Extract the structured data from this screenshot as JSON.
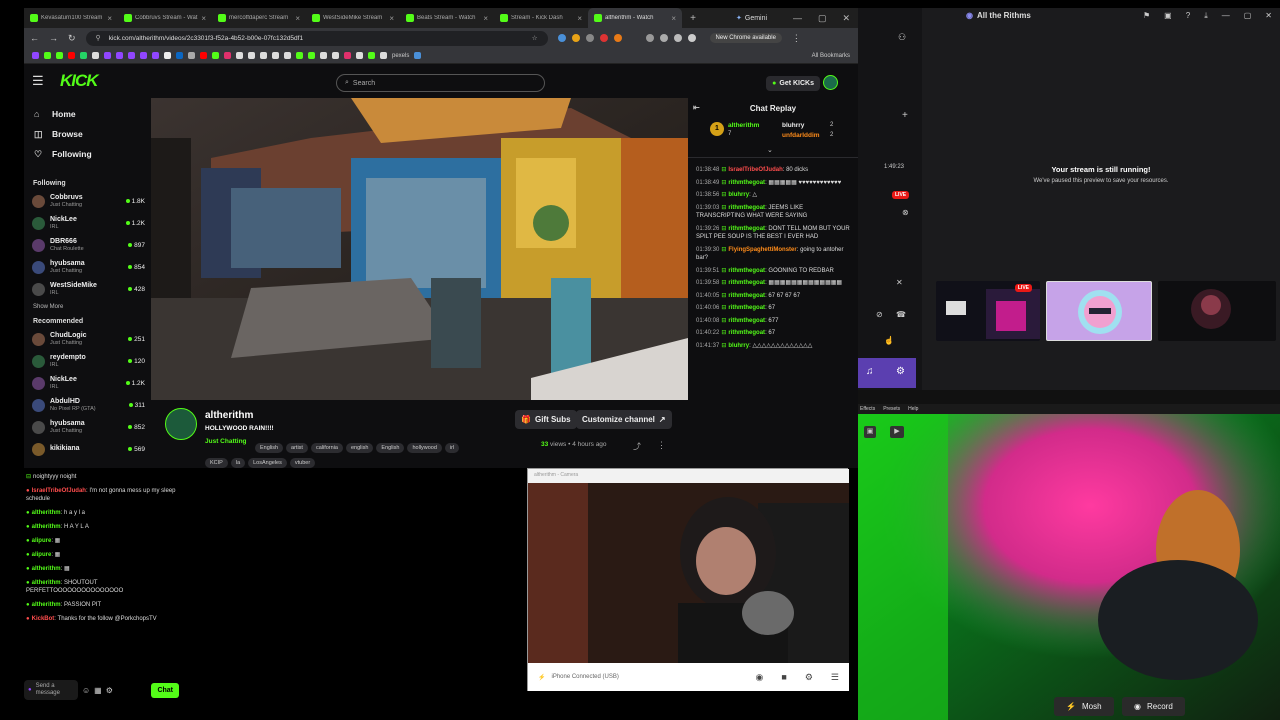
{
  "browser": {
    "tabs": [
      {
        "title": "Kevasaturn100 Stream - W"
      },
      {
        "title": "Cobbruvs Stream - Wat"
      },
      {
        "title": "mercoffdaperc Stream"
      },
      {
        "title": "WestSideMike Stream"
      },
      {
        "title": "Beats Stream - Watch"
      },
      {
        "title": "Stream - Kick Dash"
      },
      {
        "title": "altherithm - Watch"
      }
    ],
    "new_tab": "+",
    "gemini_tab": "Gemini",
    "url": "kick.com/altherithm/videos/2c3301f3-f52a-4b52-b00e-07fc132d5df1",
    "new_chrome": "New Chrome available",
    "bookmark_pexels": "pexels",
    "all_bookmarks": "All Bookmarks"
  },
  "kick": {
    "logo": "KICK",
    "search_placeholder": "Search",
    "get_kicks": "Get KICKs",
    "nav": [
      {
        "label": "Home",
        "icon": "home-icon"
      },
      {
        "label": "Browse",
        "icon": "browse-icon"
      },
      {
        "label": "Following",
        "icon": "heart-icon"
      }
    ],
    "following_header": "Following",
    "following": [
      {
        "name": "Cobbruvs",
        "category": "Just Chatting",
        "viewers": "1.8K"
      },
      {
        "name": "NickLee",
        "category": "IRL",
        "viewers": "1.2K"
      },
      {
        "name": "DBR666",
        "category": "Chat Roulette",
        "viewers": "897"
      },
      {
        "name": "hyubsama",
        "category": "Just Chatting",
        "viewers": "854"
      },
      {
        "name": "WestSideMike",
        "category": "IRL",
        "viewers": "428"
      }
    ],
    "show_more": "Show More",
    "recommended_header": "Recommended",
    "recommended": [
      {
        "name": "ChudLogic",
        "category": "Just Chatting",
        "viewers": "251"
      },
      {
        "name": "reydempto",
        "category": "IRL",
        "viewers": "120"
      },
      {
        "name": "NickLee",
        "category": "IRL",
        "viewers": "1.2K"
      },
      {
        "name": "AbdulHD",
        "category": "No Pixel RP (GTA)",
        "viewers": "311"
      },
      {
        "name": "hyubsama",
        "category": "Just Chatting",
        "viewers": "852"
      },
      {
        "name": "kikikiana",
        "category": "",
        "viewers": "569"
      }
    ],
    "channel": {
      "name": "altherithm",
      "title": "HOLLYWOOD RAIN!!!!",
      "category": "Just Chatting",
      "tags_row1": [
        "English",
        "artist",
        "california",
        "english",
        "English",
        "hollywood",
        "irl"
      ],
      "tags_row2": [
        "KCIP",
        "la",
        "LosAngeles",
        "vtuber"
      ],
      "gift_subs": "Gift Subs",
      "customize": "Customize channel",
      "views_count": "33",
      "views_label": "views",
      "time_ago": "4 hours ago"
    },
    "chat": {
      "title": "Chat Replay",
      "leaders": [
        {
          "rank": "1",
          "name": "altherithm",
          "count": "7"
        },
        {
          "name": "bluhrry",
          "count": "2"
        },
        {
          "name": "unfdarlddim",
          "count": "2"
        }
      ],
      "messages": [
        {
          "time": "01:38:48",
          "user": "IsraelTribeOfJudah",
          "color": "r",
          "text": ": 80 dicks"
        },
        {
          "time": "01:38:49",
          "user": "rithmthegoat",
          "color": "g",
          "text": ": ▦▦▦▦▦ ♥♥♥♥♥♥♥♥♥♥♥♥"
        },
        {
          "time": "01:38:56",
          "user": "bluhrry",
          "color": "g",
          "text": ": △"
        },
        {
          "time": "01:39:03",
          "user": "rithmthegoat",
          "color": "g",
          "text": ": JEEMS LIKE TRANSCRIPTING WHAT WERE SAYING"
        },
        {
          "time": "01:39:26",
          "user": "rithmthegoat",
          "color": "g",
          "text": ": DONT TELL MOM BUT YOUR SPILT PEE SOUP IS THE BEST I EVER HAD"
        },
        {
          "time": "01:39:30",
          "user": "FlyingSpaghettiMonster",
          "color": "o",
          "text": ": going to antoher bar?"
        },
        {
          "time": "01:39:51",
          "user": "rithmthegoat",
          "color": "g",
          "text": ": GOONING TO REDBAR"
        },
        {
          "time": "01:39:58",
          "user": "rithmthegoat",
          "color": "g",
          "text": ": ▦▦▦▦▦▦▦▦▦▦▦▦▦"
        },
        {
          "time": "01:40:05",
          "user": "rithmthegoat",
          "color": "g",
          "text": ": 67 67 67 67"
        },
        {
          "time": "01:40:06",
          "user": "rithmthegoat",
          "color": "g",
          "text": ": 67"
        },
        {
          "time": "01:40:08",
          "user": "rithmthegoat",
          "color": "g",
          "text": ": 677"
        },
        {
          "time": "01:40:22",
          "user": "rithmthegoat",
          "color": "g",
          "text": ": 67"
        },
        {
          "time": "01:41:37",
          "user": "bluhrry",
          "color": "g",
          "text": ": △△△△△△△△△△△△△"
        }
      ]
    }
  },
  "left_chat": {
    "messages": [
      {
        "user": "",
        "text": "noightyyy noight"
      },
      {
        "user": "IsraelTribeOfJudah",
        "color": "r",
        "text": ": I'm not gonna mess up my sleep schedule"
      },
      {
        "user": "altherithm",
        "color": "g",
        "text": ": h a y l a"
      },
      {
        "user": "altherithm",
        "color": "g",
        "text": ": H A Y L A"
      },
      {
        "user": "alipure",
        "color": "g",
        "text": ": ▦"
      },
      {
        "user": "alipure",
        "color": "g",
        "text": ": ▦"
      },
      {
        "user": "altherithm",
        "color": "g",
        "text": ": ▦"
      },
      {
        "user": "altherithm",
        "color": "g",
        "text": ": SHOUTOUT PERFETTOOOOOOOOOOOOOOO"
      },
      {
        "user": "altherithm",
        "color": "g",
        "text": ": PASSION PIT"
      },
      {
        "user": "KickBot",
        "color": "r",
        "text": ": Thanks for the follow @PorkchopsTV"
      }
    ],
    "send_placeholder": "Send a message",
    "chat_button": "Chat"
  },
  "obs": {
    "title": "All the Rithms",
    "stream_running": "Your stream is still running!",
    "stream_paused": "We've paused this preview to save your resources.",
    "timer": "1:49:23",
    "live": "LIVE",
    "thumb_live": "LIVE"
  },
  "camera": {
    "window_title": "altherithm - Camera",
    "status": "iPhone Connected (USB)"
  },
  "fx": {
    "menu": [
      "Effects",
      "Presets",
      "Help"
    ],
    "mosh": "Mosh",
    "record": "Record"
  }
}
